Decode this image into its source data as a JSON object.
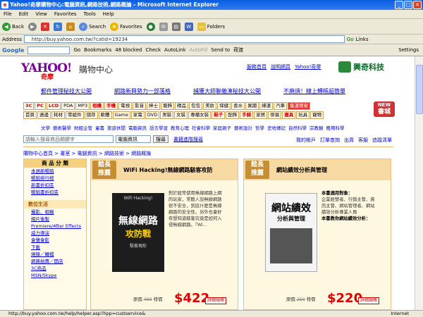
{
  "window": {
    "title": "Yahoo!奇摩購物中心:電腦資訊,網路技術,網路概論 - Microsoft Internet Explorer"
  },
  "menu": [
    "File",
    "Edit",
    "View",
    "Favorites",
    "Tools",
    "Help"
  ],
  "toolbar": {
    "back": "Back",
    "search": "Search",
    "favorites": "Favorites",
    "folders": "Folders"
  },
  "address": {
    "label": "Address",
    "url": "http://buy.yahoo.com.tw/?catid=19234",
    "go": "Go",
    "links": "Links"
  },
  "googlebar": {
    "brand": "Google",
    "go": "Go",
    "bookmarks": "Bookmarks",
    "blocked": "48 blocked",
    "check": "Check",
    "autolink": "AutoLink",
    "autofill": "AutoFill",
    "sendto": "Send to",
    "extra": "荷渡",
    "settings": "Settings"
  },
  "site": {
    "logo": "YAHOO!",
    "logo_sub": "奇摩",
    "title": "購物中心",
    "toplinks": [
      "服務首頁",
      "說明網頁",
      "Yahoo!奇摩"
    ],
    "brand": "興奇科技",
    "promos": [
      "郵件管理秘技大公開",
      "網路新興勢力一部落格",
      "捕獲大師聯雜湊秘技大公開",
      "不麻煩！線上轉帳超簡單"
    ],
    "tabs_row1": [
      "3C",
      "PC",
      "LCD",
      "PDA",
      "MP3",
      "相機",
      "手機",
      "電視",
      "影音",
      "紳士",
      "服飾",
      "精品",
      "包包",
      "美妝",
      "保健",
      "香水",
      "異國",
      "練運",
      "汽車",
      "集運賞家"
    ],
    "tabs_row2": [
      "首頁",
      "週邊",
      "耗材",
      "零組件",
      "儲存",
      "軟體",
      "Game",
      "家電",
      "DVD",
      "男裝",
      "女裝",
      "專櫃女裝",
      "鞋子",
      "配飾",
      "手錶",
      "家居",
      "傢俱",
      "寢具",
      "玩具",
      "寵物"
    ],
    "new_badge": [
      "NEW",
      "書城"
    ],
    "sublinks": [
      "文學",
      "藝術醫學",
      "財經企管",
      "童書",
      "旅遊休閒",
      "電腦資訊",
      "語言學習",
      "教育心理",
      "社會科學",
      "家庭親子",
      "藝術設計",
      "哲學",
      "史地傳記",
      "自然科學",
      "宗教類",
      "應用科學"
    ],
    "search_placeholder": "請輸入搜尋商品關鍵字",
    "search_cat": "電腦資訊",
    "search_btn": "搜尋",
    "adv_search": "書籍進階搜尋",
    "userlinks": [
      "我的帳戶",
      "訂單查詢",
      "出貨",
      "客服",
      "追蹤清單"
    ],
    "breadcrumb": "購物中心首頁 > 書室 > 電腦資訊 > 網路技術 > 網路概論",
    "sidebar": {
      "header": "商 品 分 類",
      "items1": [
        "本週新暢銷",
        "暢銷排行榜",
        "新書折扣區",
        "暢銷書折扣區"
      ],
      "header2": "數位生活",
      "items2": [
        "攝影、相機",
        "相片後製",
        "Premiere/After Effects",
        "威力導演",
        "會聲會影",
        "下載",
        "燒錄／轉檔",
        "網路拍賣／開店",
        "3C商品",
        "MSN/Skype"
      ]
    }
  },
  "cards": [
    {
      "badge": [
        "館長",
        "推薦"
      ],
      "title": "WiFi Hacking!無線網路駭客攻防",
      "cover_top": "WiFi Hacking!",
      "cover_main": "無線網路",
      "cover_sub": "攻防戰",
      "cover_note": "駭客現形",
      "desc": "對於經常使用無線網路上網的玩家，常聽人說無線網路很不安全，到底什麼是無線網路的安全性，另外也會好奇想知道駭客究竟是如何入侵無線網路。『Wi...",
      "price_label": "原價",
      "orig_price": "490",
      "special_label": "特價",
      "sale_price": "422",
      "detail": "詳細規格"
    },
    {
      "badge": [
        "館長",
        "推薦"
      ],
      "title": "網站績效分析與管理",
      "cover_main": "網站績效",
      "cover_sub": "分析與管理",
      "desc_head": "本書適用對象：",
      "desc": "企業經營者、行銷主管、資訊主管、網站管理者、網站績效分析專業人員",
      "desc_head2": "本書教你網站績效分析：",
      "price_label": "原價",
      "orig_price": "250",
      "special_label": "特價",
      "sale_price": "220",
      "detail": "詳細規格"
    }
  ],
  "status": {
    "text": "http://buy.yahoo.com.tw/help/helper.asp?hpp=custservice&",
    "zone": "Internet"
  }
}
